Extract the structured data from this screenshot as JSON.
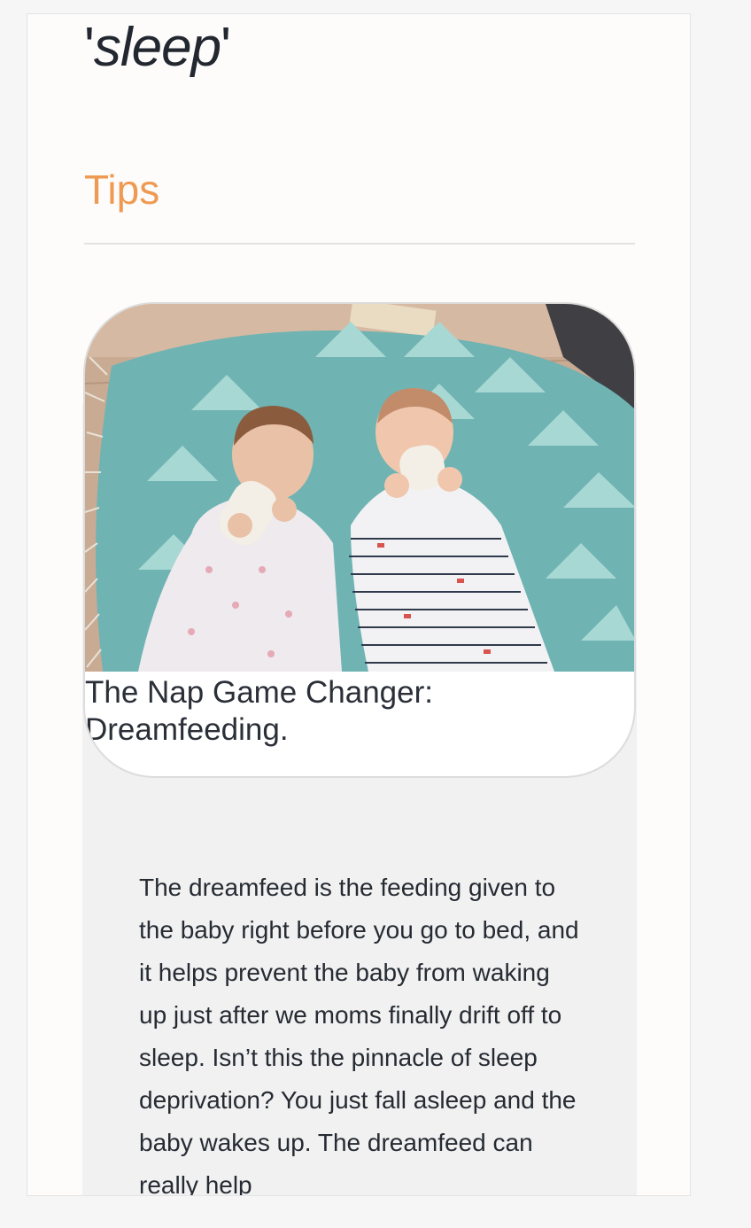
{
  "header": {
    "quote_open": "'",
    "brand_word": "sleep",
    "quote_close": "'"
  },
  "section": {
    "title": "Tips"
  },
  "article": {
    "image_alt": "Two babies lying on a teal patterned blanket drinking from bottles",
    "title": "The Nap Game Changer: Dreamfeeding.",
    "body": "The dreamfeed is the feeding given to the baby right before you go to bed, and it helps prevent the baby from waking up just after we moms finally drift off to sleep. Isn’t this the pinnacle of sleep deprivation? You just fall asleep and the baby wakes up. The dreamfeed can really help"
  },
  "colors": {
    "accent": "#ef9a52",
    "text": "#262b33",
    "page": "#fdfcfb",
    "article_bg": "#f1f1f1",
    "blanket": "#6fb3b3"
  }
}
